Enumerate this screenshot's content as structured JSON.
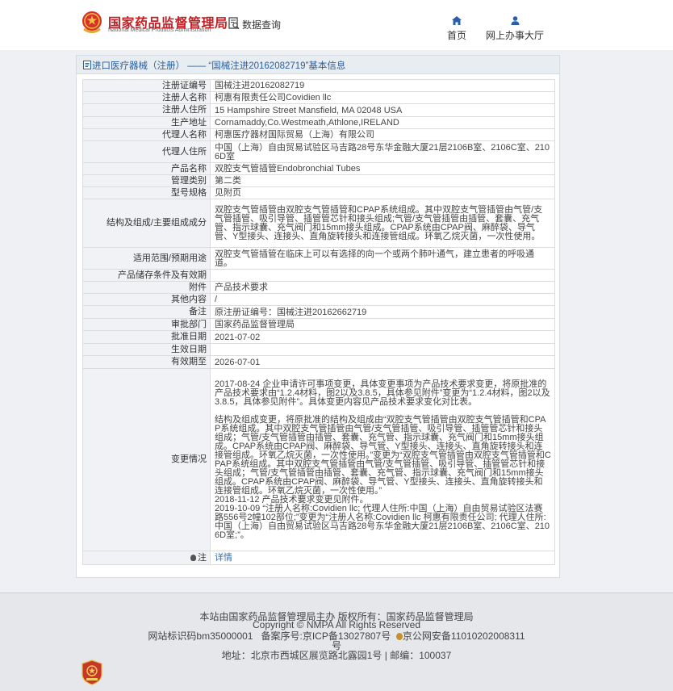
{
  "header": {
    "logo_cn": "国家药品监督管理局",
    "logo_en": "National Medical Products Administration",
    "data_query_label": "数据查询",
    "nav_home_label": "首页",
    "nav_online_label": "网上办事大厅"
  },
  "panel": {
    "title_prefix": "进口医疗器械（注册）",
    "title_sep": " —— ",
    "title_quote": "“国械注进20162082719”",
    "title_suffix": "基本信息"
  },
  "rows": [
    {
      "key": "注册证编号",
      "value": "国械注进20162082719"
    },
    {
      "key": "注册人名称",
      "value": "柯惠有限责任公司Covidien llc"
    },
    {
      "key": "注册人住所",
      "value": "15 Hampshire Street Mansfield, MA 02048 USA"
    },
    {
      "key": "生产地址",
      "value": "Cornamaddy,Co.Westmeath,Athlone,IRELAND"
    },
    {
      "key": "代理人名称",
      "value": "柯惠医疗器材国际贸易（上海）有限公司"
    },
    {
      "key": "代理人住所",
      "value": "中国（上海）自由贸易试验区马吉路28号东华金融大厦21层2106B室、2106C室、2106D室"
    },
    {
      "key": "产品名称",
      "value": "双腔支气管插管Endobronchial Tubes"
    },
    {
      "key": "管理类别",
      "value": "第二类"
    },
    {
      "key": "型号规格",
      "value": "见附页"
    },
    {
      "key": "结构及组成/主要组成成分",
      "value": "双腔支气管插管由双腔支气管插管和CPAP系统组成。其中双腔支气管插管由气管/支气管插管、吸引导管、插管管芯针和接头组成;气管/支气管插管由插管、套囊、充气管、指示球囊、充气阀门和15mm接头组成。CPAP系统由CPAP阀、麻醉袋、导气管、Y型接头、连接头、直角旋转接头和连接管组成。环氧乙烷灭菌，一次性使用。"
    },
    {
      "key": "适用范围/预期用途",
      "value": "双腔支气管插管在临床上可以有选择的向一个或两个肺叶通气，建立患者的呼吸通道。"
    },
    {
      "key": "产品储存条件及有效期",
      "value": ""
    },
    {
      "key": "附件",
      "value": "产品技术要求"
    },
    {
      "key": "其他内容",
      "value": "/"
    },
    {
      "key": "备注",
      "value": "原注册证编号：国械注进20162662719"
    },
    {
      "key": "审批部门",
      "value": "国家药品监督管理局"
    },
    {
      "key": "批准日期",
      "value": "2021-07-02"
    },
    {
      "key": "生效日期",
      "value": ""
    },
    {
      "key": "有效期至",
      "value": "2026-07-01"
    }
  ],
  "change_row": {
    "key": "变更情况",
    "value": "2017-08-24 企业申请许可事项变更，具体变更事项为产品技术要求变更，将原批准的产品技术要求由“1.2.4材料，图2以及3.8.5，具体参见附件”变更为“1.2.4材料，图2以及3.8.5，具体参见附件”。具体变更内容见产品技术要求变化对比表。\n\n结构及组成变更，将原批准的结构及组成由“双腔支气管插管由双腔支气管插管和CPAP系统组成。其中双腔支气管插管由气管/支气管插管、吸引导管、插管管芯针和接头组成；气管/支气管插管由插管、套囊、充气管、指示球囊、充气阀门和15mm接头组成。CPAP系统由CPAP阀、麻醉袋、导气管、Y型接头、连接头、直角旋转接头和连接管组成。环氧乙烷灭菌，一次性使用。”变更为“双腔支气管插管由双腔支气管插管和CPAP系统组成。其中双腔支气管插管由气管/支气管插管、吸引导管、插管管芯针和接头组成；气管/支气管插管由插管、套囊、充气管、指示球囊、充气阀门和15mm接头组成。CPAP系统由CPAP阀、麻醉袋、导气管、Y型接头、连接头、直角旋转接头和连接管组成。环氧乙烷灭菌，一次性使用。”\n2018-11-12 产品技术要求变更见附件。\n2019-10-09 “注册人名称:Covidien llc; 代理人住所:中国（上海）自由贸易试验区法赛路556号2幢102部位;”变更为“注册人名称:Covidien llc 柯惠有限责任公司; 代理人住所:中国（上海）自由贸易试验区马吉路28号东华金融大厦21层2106B室、2106C室、2106D室;”。"
  },
  "note_row": {
    "key": "注",
    "link": "详情"
  },
  "footer": {
    "line1": "本站由国家药品监督管理局主办 版权所有：国家药品监督管理局",
    "line2": "Copyright © NMPA All Rights Reserved",
    "line3a": "网站标识码bm35000001",
    "line3b": "备案序号:京ICP备13027807号",
    "line3c": "京公网安备11010202008311",
    "line4": "号",
    "line5": "地址：北京市西城区展览路北露园1号 | 邮编：100037"
  }
}
